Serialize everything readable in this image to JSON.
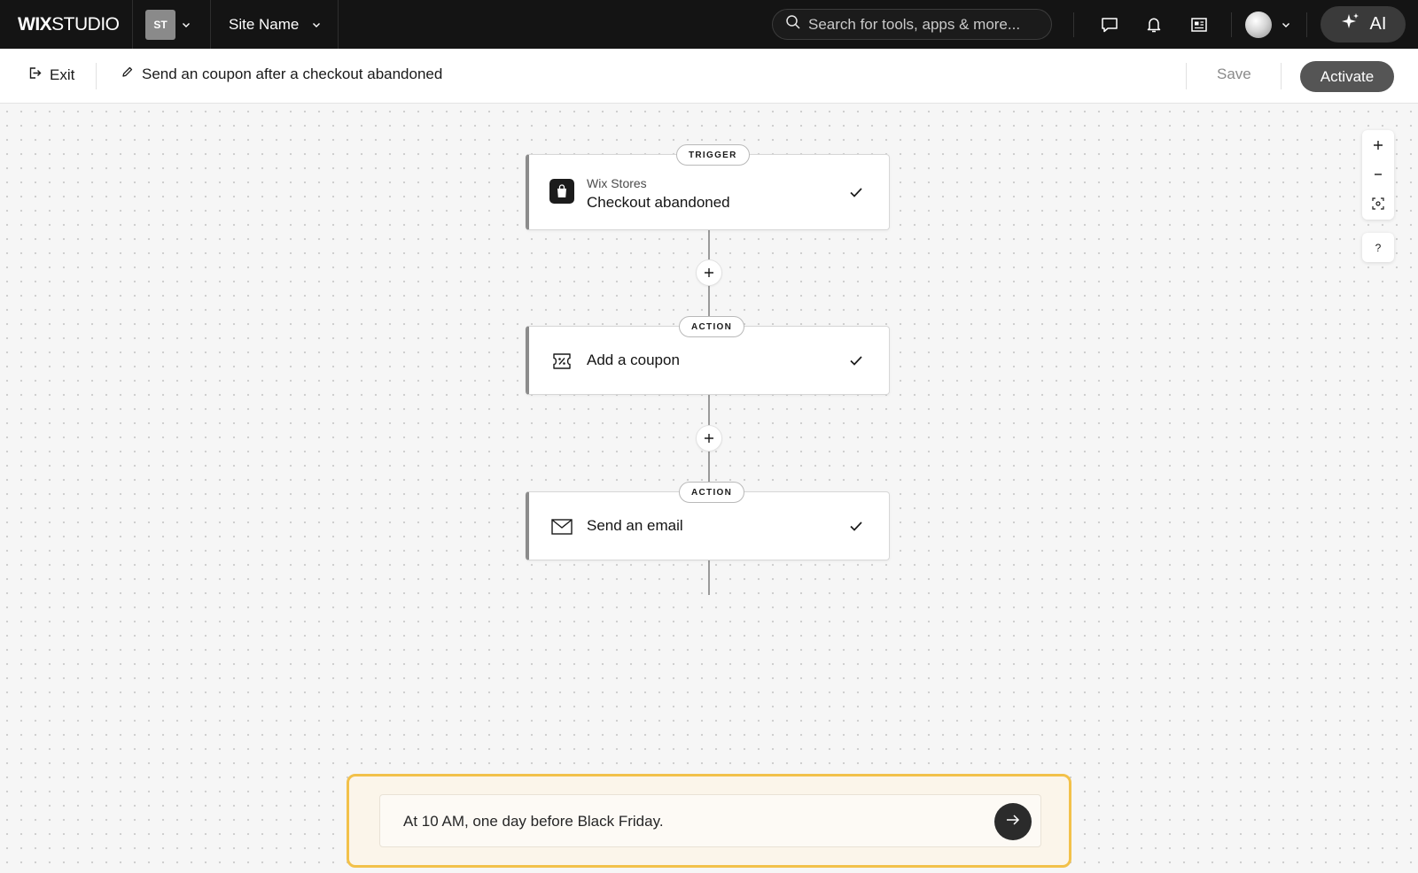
{
  "topbar": {
    "logo_bold": "WIX",
    "logo_light": "STUDIO",
    "site_badge": "ST",
    "site_name": "Site Name",
    "search_placeholder": "Search for tools, apps & more...",
    "ai_label": "AI"
  },
  "subbar": {
    "exit_label": "Exit",
    "flow_title": "Send an coupon after a checkout abandoned",
    "save_label": "Save",
    "activate_label": "Activate"
  },
  "flow": {
    "trigger": {
      "tag": "TRIGGER",
      "app": "Wix Stores",
      "label": "Checkout abandoned",
      "icon": "shopping-bag-icon"
    },
    "actions": [
      {
        "tag": "ACTION",
        "label": "Add a coupon",
        "icon": "coupon-icon"
      },
      {
        "tag": "ACTION",
        "label": "Send an email",
        "icon": "envelope-icon"
      }
    ]
  },
  "canvas_controls": {
    "zoom_in": "+",
    "zoom_out": "−",
    "help": "?"
  },
  "prompt": {
    "value": "At 10 AM, one day before Black Friday."
  },
  "colors": {
    "topbar_bg": "#141414",
    "accent_outline": "#f2c14a",
    "activate_bg": "#555555"
  }
}
